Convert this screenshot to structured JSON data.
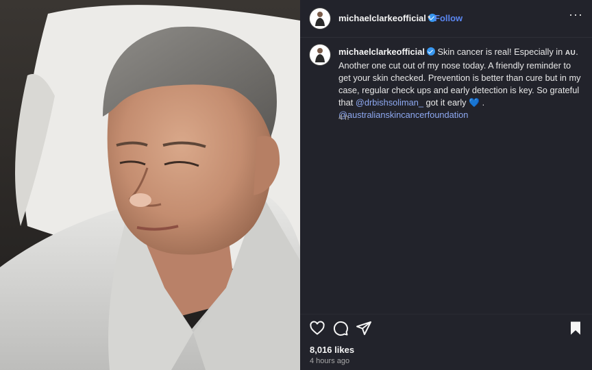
{
  "header": {
    "username": "michaelclarkeofficial",
    "separator": "•",
    "follow_label": "Follow",
    "more_icon": "more-horizontal-icon"
  },
  "caption": {
    "username": "michaelclarkeofficial",
    "text_1": " Skin cancer is real! Especially in ",
    "text_au": "AU",
    "text_2": ". Another one cut out of my nose today. A friendly reminder to get your skin checked. Prevention is better than cure but in my case, regular check ups and early detection is key. So grateful that ",
    "mention_1": "@drbishsoliman_",
    "text_3": " got it early ",
    "emoji": "💙",
    "text_4": " .",
    "mention_2": "@australianskincancerfoundation",
    "time": "4 h"
  },
  "actions": {
    "like_icon": "heart-icon",
    "comment_icon": "comment-icon",
    "share_icon": "share-icon",
    "save_icon": "bookmark-icon"
  },
  "likes": "8,016 likes",
  "posted": "4 hours ago",
  "colors": {
    "panel_bg": "#22232b",
    "link_blue": "#5a86f0",
    "verified_blue": "#3897f0"
  }
}
